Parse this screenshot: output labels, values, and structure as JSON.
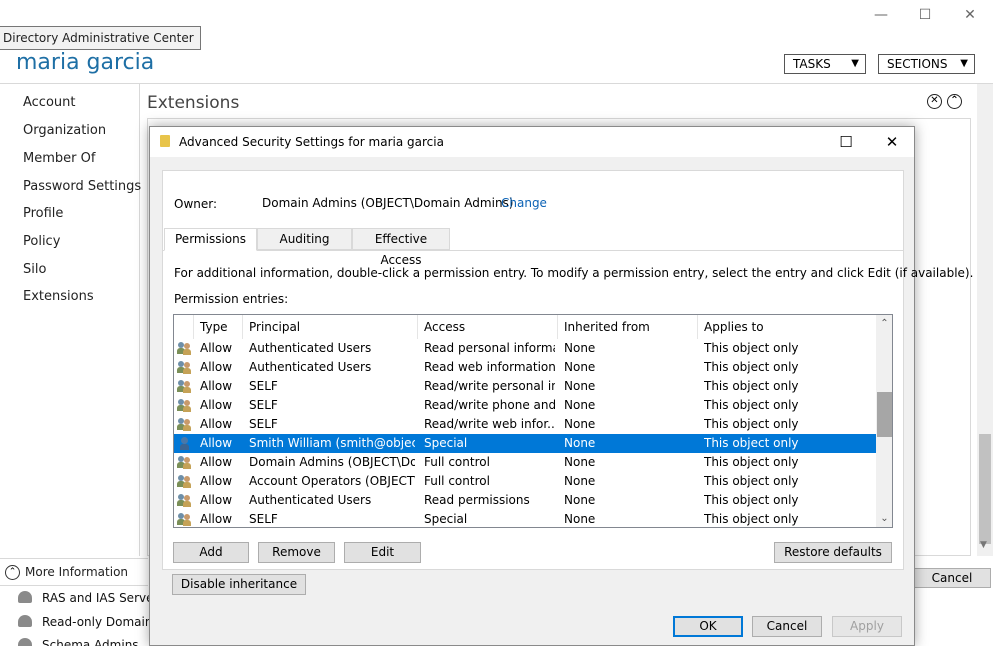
{
  "app": {
    "tooltip": "Directory Administrative Center",
    "window_controls": {
      "minimize": "—",
      "maximize": "☐",
      "close": "✕"
    }
  },
  "header": {
    "user_title": "maria garcia",
    "tasks_label": "TASKS",
    "sections_label": "SECTIONS",
    "dropdown_arrow": "▼"
  },
  "nav": {
    "items": [
      "Account",
      "Organization",
      "Member Of",
      "Password Settings",
      "Profile",
      "Policy",
      "Silo",
      "Extensions"
    ]
  },
  "section": {
    "title": "Extensions",
    "close_glyph": "✕",
    "collapse_glyph": "⌃"
  },
  "more_info": {
    "icon": "⌃",
    "label": "More Information"
  },
  "background_list": {
    "items": [
      "RAS and IAS Servers",
      "Read-only Domain C",
      "Schema Admins"
    ]
  },
  "background_cancel": "Cancel",
  "dialog": {
    "title": "Advanced Security Settings for maria garcia",
    "controls": {
      "maximize": "☐",
      "close": "✕"
    },
    "owner_label": "Owner:",
    "owner_value": "Domain Admins (OBJECT\\Domain Admins)",
    "owner_change": "Change",
    "tabs": [
      {
        "label": "Permissions",
        "active": true
      },
      {
        "label": "Auditing",
        "active": false
      },
      {
        "label": "Effective Access",
        "active": false
      }
    ],
    "info_text": "For additional information, double-click a permission entry. To modify a permission entry, select the entry and click Edit (if available).",
    "entries_label": "Permission entries:",
    "columns": [
      "Type",
      "Principal",
      "Access",
      "Inherited from",
      "Applies to"
    ],
    "rows": [
      {
        "icon": "group",
        "type": "Allow",
        "principal": "Authenticated Users",
        "access": "Read personal informa...",
        "inherited": "None",
        "applies": "This object only",
        "selected": false
      },
      {
        "icon": "group",
        "type": "Allow",
        "principal": "Authenticated Users",
        "access": "Read web information",
        "inherited": "None",
        "applies": "This object only",
        "selected": false
      },
      {
        "icon": "group",
        "type": "Allow",
        "principal": "SELF",
        "access": "Read/write personal in...",
        "inherited": "None",
        "applies": "This object only",
        "selected": false
      },
      {
        "icon": "group",
        "type": "Allow",
        "principal": "SELF",
        "access": "Read/write phone and...",
        "inherited": "None",
        "applies": "This object only",
        "selected": false
      },
      {
        "icon": "group",
        "type": "Allow",
        "principal": "SELF",
        "access": "Read/write web infor...",
        "inherited": "None",
        "applies": "This object only",
        "selected": false
      },
      {
        "icon": "user",
        "type": "Allow",
        "principal": "Smith William (smith@objec...",
        "access": "Special",
        "inherited": "None",
        "applies": "This object only",
        "selected": true
      },
      {
        "icon": "group",
        "type": "Allow",
        "principal": "Domain Admins (OBJECT\\Do...",
        "access": "Full control",
        "inherited": "None",
        "applies": "This object only",
        "selected": false
      },
      {
        "icon": "group",
        "type": "Allow",
        "principal": "Account Operators (OBJECT\\...",
        "access": "Full control",
        "inherited": "None",
        "applies": "This object only",
        "selected": false
      },
      {
        "icon": "group",
        "type": "Allow",
        "principal": "Authenticated Users",
        "access": "Read permissions",
        "inherited": "None",
        "applies": "This object only",
        "selected": false
      },
      {
        "icon": "group",
        "type": "Allow",
        "principal": "SELF",
        "access": "Special",
        "inherited": "None",
        "applies": "This object only",
        "selected": false
      }
    ],
    "scroll_up": "⌃",
    "scroll_down": "⌄",
    "buttons": {
      "add": "Add",
      "remove": "Remove",
      "edit": "Edit",
      "restore_defaults": "Restore defaults",
      "disable_inheritance": "Disable inheritance",
      "ok": "OK",
      "cancel": "Cancel",
      "apply": "Apply"
    }
  },
  "colors": {
    "accent": "#0078d7",
    "title_blue": "#1e6fa5",
    "link": "#0b62b5"
  }
}
